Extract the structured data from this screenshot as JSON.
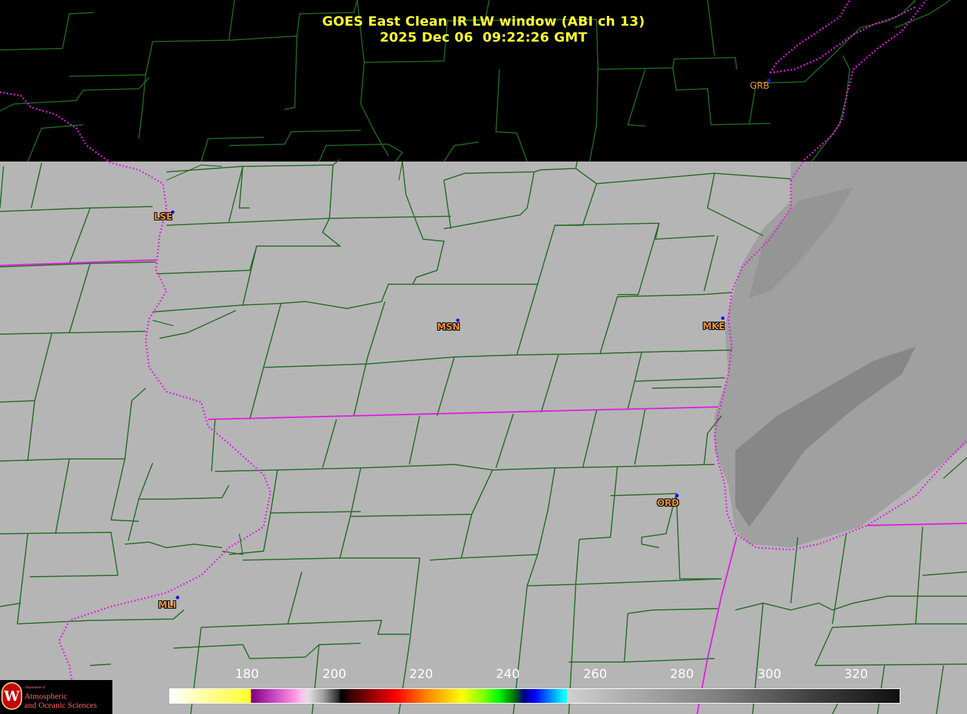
{
  "title": {
    "line1": "GOES East Clean IR LW window (ABI ch 13)",
    "line2": "2025 Dec 06  09:22:26 GMT"
  },
  "cities": [
    {
      "code": "GRB",
      "lon_lat_hint": "Green Bay"
    },
    {
      "code": "LSE",
      "lon_lat_hint": "La Crosse"
    },
    {
      "code": "MSN",
      "lon_lat_hint": "Madison"
    },
    {
      "code": "MKE",
      "lon_lat_hint": "Milwaukee"
    },
    {
      "code": "ORD",
      "lon_lat_hint": "Chicago O'Hare"
    },
    {
      "code": "MLI",
      "lon_lat_hint": "Moline"
    }
  ],
  "colorbar": {
    "ticks": [
      "180",
      "200",
      "220",
      "240",
      "260",
      "280",
      "300",
      "320"
    ],
    "tick_values": [
      180,
      200,
      220,
      240,
      260,
      280,
      300,
      320
    ],
    "range": [
      163,
      330
    ]
  },
  "colors": {
    "background": "#000000",
    "ground": "#b5b5b5",
    "county_lines": "#1f6b1f",
    "state_lines": "#e020e0",
    "title": "#ffff33",
    "city_label": "#f0923a",
    "city_dot": "#1010ff"
  },
  "logo": {
    "small": "Department of",
    "line1": "Atmospheric",
    "line2": "and Oceanic Sciences",
    "seal": "W"
  }
}
